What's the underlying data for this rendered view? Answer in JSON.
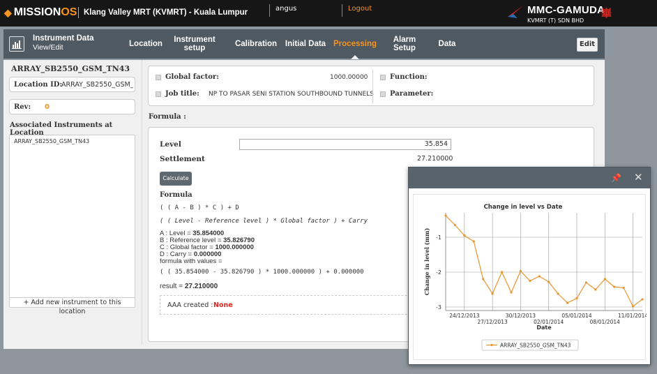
{
  "topbar": {
    "logo_prefix": "MISSION",
    "logo_suffix": "OS",
    "project": "Klang Valley MRT (KVMRT) - Kuala Lumpur",
    "user": "angus",
    "logout": "Logout",
    "brand_name": "MMC-GAMUDA",
    "brand_sub": "KVMRT (T) SDN BHD",
    "brand_flag_glyph": "崋"
  },
  "nav": {
    "title": "Instrument Data",
    "subtitle": "View/Edit",
    "items": [
      "Location",
      "Instrument setup",
      "Calibration",
      "Initial Data",
      "Processing",
      "Alarm Setup",
      "Data"
    ],
    "active": "Processing",
    "edit": "Edit"
  },
  "left": {
    "instrument_name": "ARRAY_SB2550_GSM_TN43",
    "location_id_label": "Location ID:",
    "location_id_value": "ARRAY_SB2550_GSM_...",
    "rev_label": "Rev:",
    "rev_value": "0",
    "assoc_title": "Associated Instruments at Location",
    "assoc_items": [
      "ARRAY_SB2550_GSM_TN43"
    ],
    "add_instrument": "+ Add new instrument to this location"
  },
  "params": {
    "global_factor_label": "Global factor:",
    "global_factor_value": "1000.00000",
    "job_title_label": "Job title:",
    "job_title_value": "NP TO PASAR SENI STATION SOUTHBOUND TUNNELS",
    "function_label": "Function:",
    "parameter_label": "Parameter:"
  },
  "formula_section": {
    "heading": "Formula :",
    "level_label": "Level",
    "level_value": "35.854",
    "settlement_label": "Settlement",
    "settlement_value": "27.210000",
    "calculate": "Calculate",
    "formula_label": "Formula",
    "expr1": "( ( A - B ) * C ) + D",
    "expr2": "( ( Level - Reference level ) * Global factor ) + Carry",
    "a_label": "A : Level = ",
    "a_value": "35.854000",
    "b_label": "B : Reference level = ",
    "b_value": "35.826790",
    "c_label": "C : Global factor = ",
    "c_value": "1000.000000",
    "d_label": "D : Carry = ",
    "d_value": "0.000000",
    "with_values": "formula with values =",
    "expr3": "( ( 35.854000 - 35.826790 ) * 1000.000000 ) + 0.000000",
    "result_label": "result = ",
    "result_value": "27.210000",
    "aaa_label": "AAA created :",
    "aaa_value": "None"
  },
  "popup": {
    "pin_glyph": "📌",
    "close_glyph": "✕"
  },
  "chart_data": {
    "type": "line",
    "title": "Change in level vs Date",
    "xlabel": "Date",
    "ylabel": "Change in level (mm)",
    "ylim": [
      -3.1,
      -0.3
    ],
    "yticks": [
      -1,
      -2,
      -3
    ],
    "xtick_labels": [
      "24/12/2013",
      "27/12/2013",
      "30/12/2013",
      "02/01/2014",
      "05/01/2014",
      "08/01/2014",
      "11/01/2014"
    ],
    "grid": true,
    "legend_position": "bottom",
    "color": "#e8952e",
    "series": [
      {
        "name": "ARRAY_SB2550_GSM_TN43",
        "x": [
          "2013-12-22",
          "2013-12-23",
          "2013-12-24",
          "2013-12-25",
          "2013-12-26",
          "2013-12-27",
          "2013-12-28",
          "2013-12-29",
          "2013-12-30",
          "2013-12-31",
          "2014-01-01",
          "2014-01-02",
          "2014-01-03",
          "2014-01-04",
          "2014-01-05",
          "2014-01-06",
          "2014-01-07",
          "2014-01-08",
          "2014-01-09",
          "2014-01-10",
          "2014-01-11",
          "2014-01-12"
        ],
        "values": [
          -0.38,
          -0.65,
          -0.95,
          -1.12,
          -2.2,
          -2.62,
          -2.0,
          -2.58,
          -1.97,
          -2.25,
          -2.12,
          -2.28,
          -2.62,
          -2.88,
          -2.75,
          -2.3,
          -2.5,
          -2.2,
          -2.42,
          -2.45,
          -2.98,
          -2.78
        ]
      }
    ]
  }
}
